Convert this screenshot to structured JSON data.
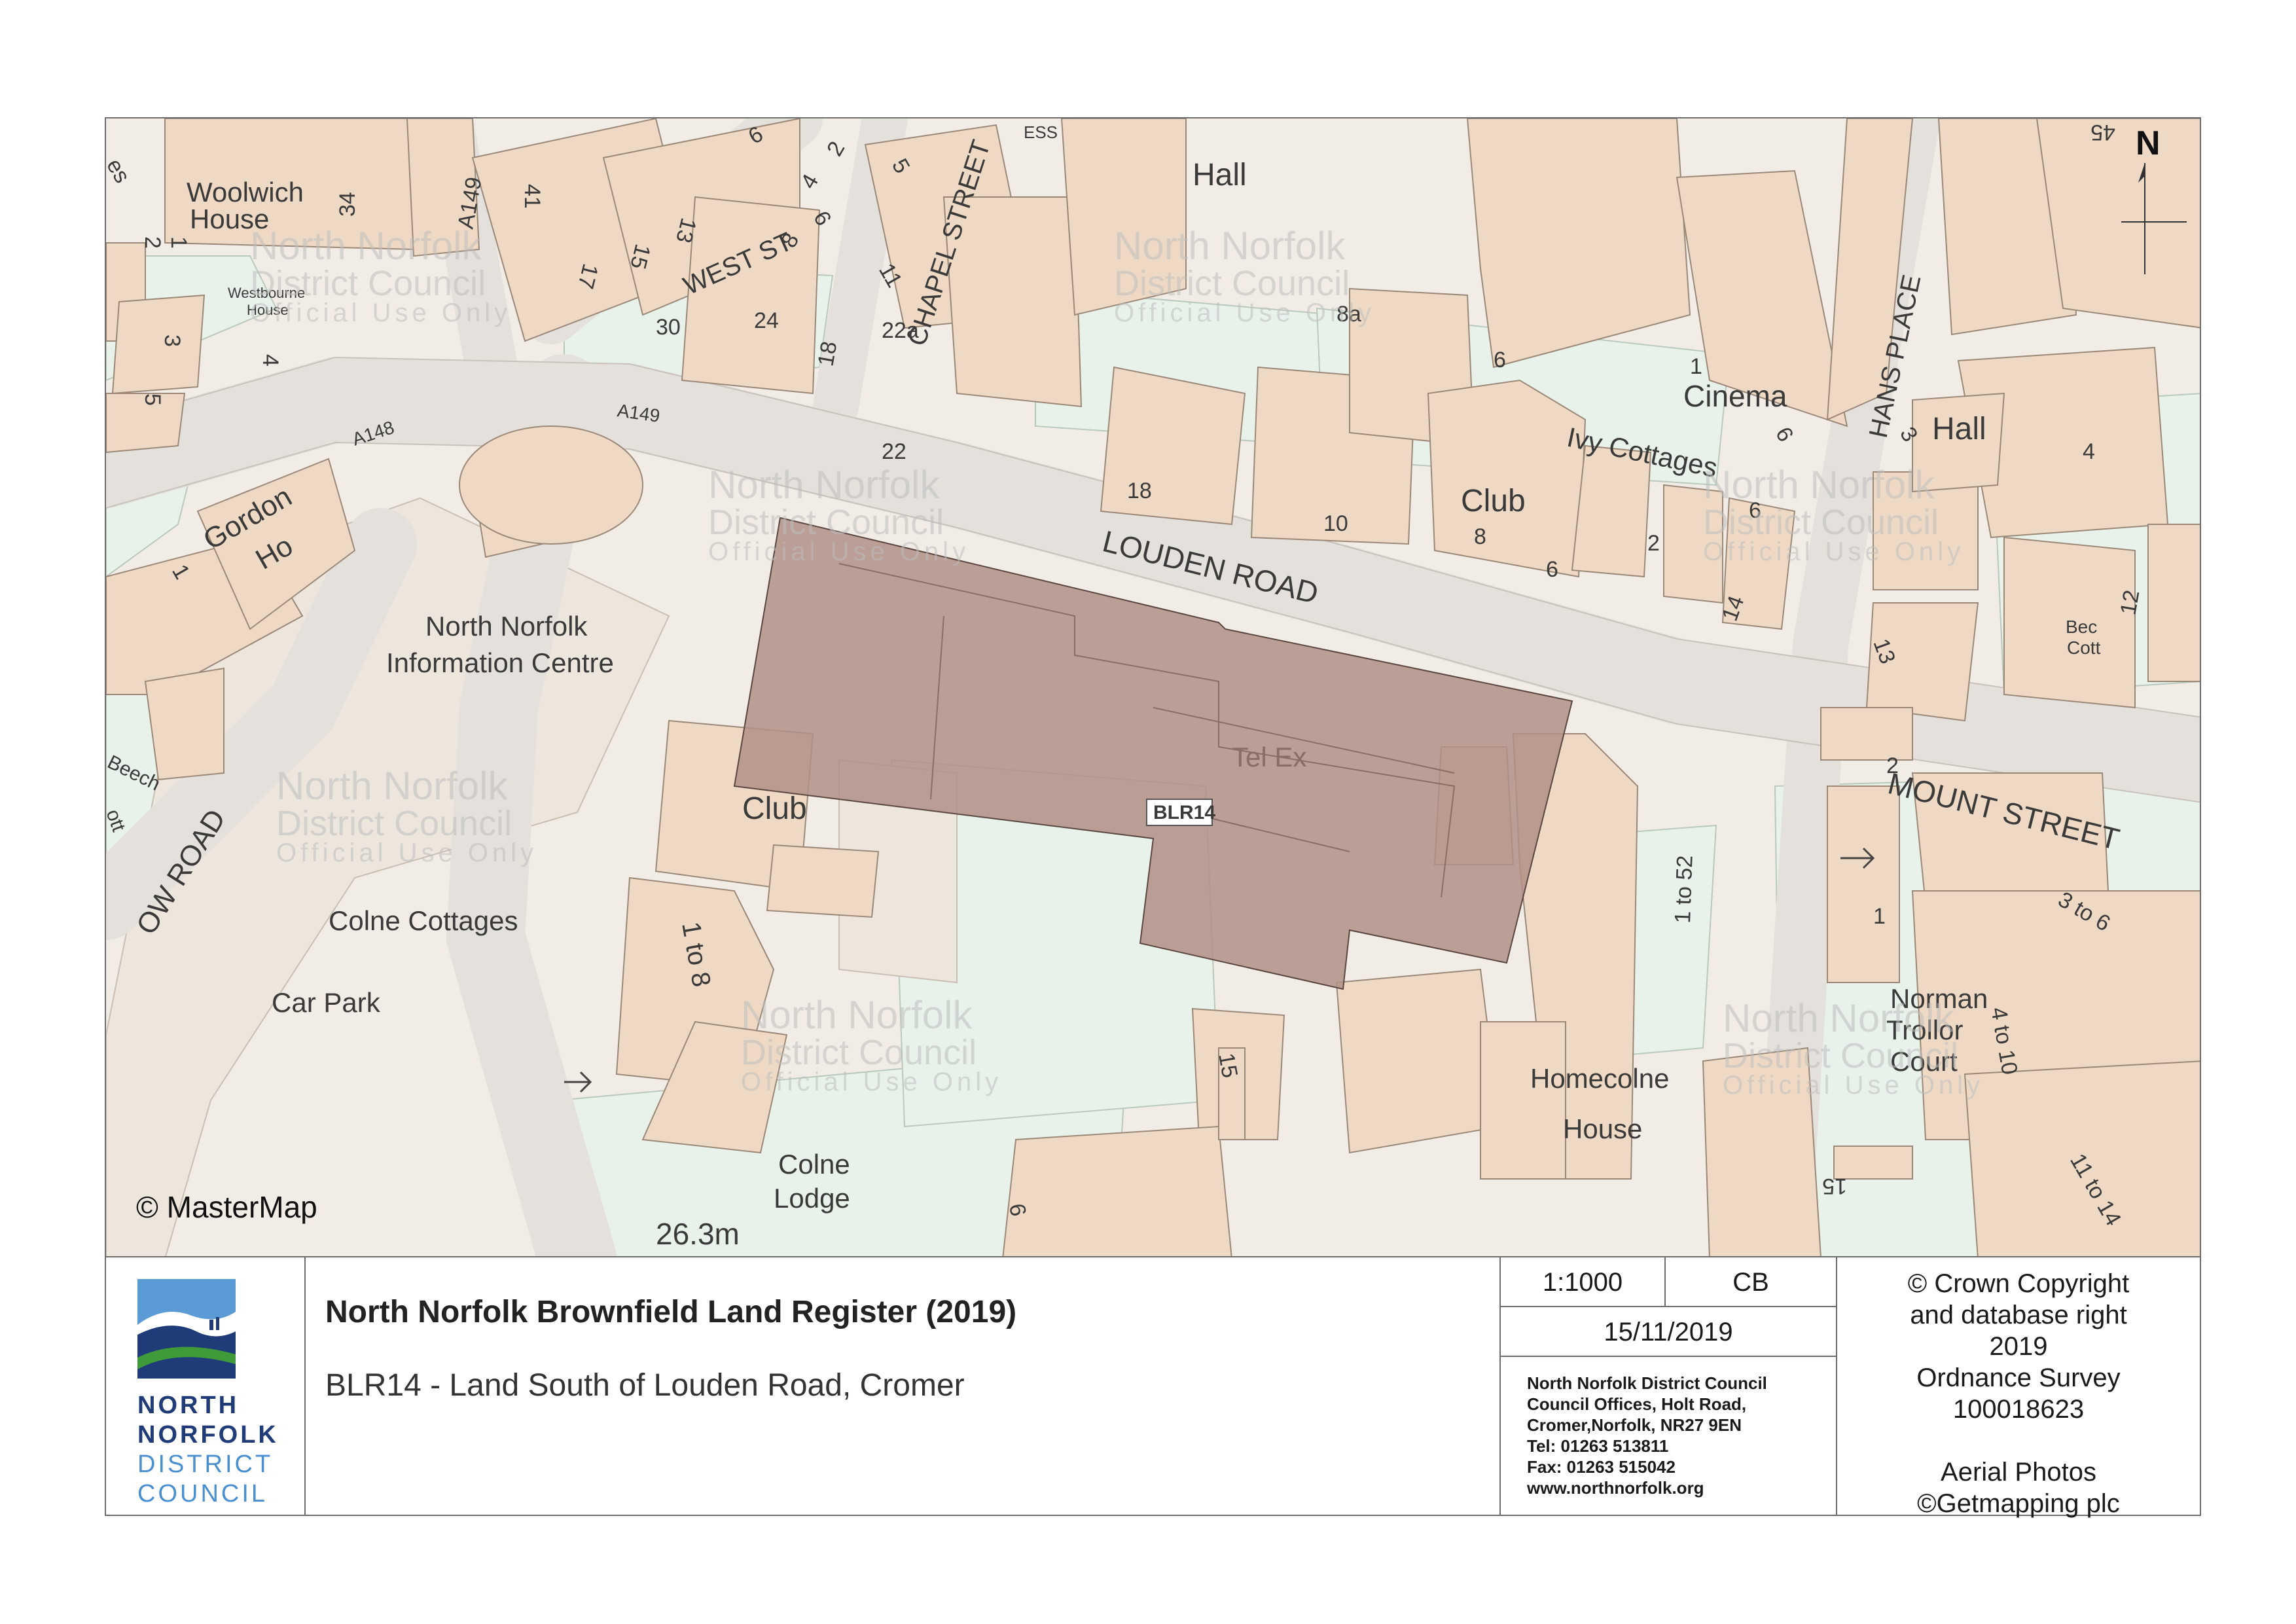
{
  "map": {
    "attribution": "© MasterMap",
    "north_label": "N",
    "site_label": "BLR14",
    "spot_height": "26.3m",
    "colors": {
      "building": "#eed9c4",
      "green_space": "#e9f2ea",
      "road": "#e7e3df",
      "site_fill": "#b28f87",
      "building_edge": "#9a8878"
    },
    "roads": [
      {
        "name": "LOUDEN   ROAD"
      },
      {
        "name": "MOUNT STREET"
      },
      {
        "name": "CHAPEL STREET"
      },
      {
        "name": "HANS PLACE"
      },
      {
        "name": "WEST ST"
      },
      {
        "name": "A149"
      },
      {
        "name": "A149"
      },
      {
        "name": "A148"
      },
      {
        "name": "OW  ROAD"
      }
    ],
    "places": [
      {
        "name": "Woolwich"
      },
      {
        "name": "House"
      },
      {
        "name": "Hall"
      },
      {
        "name": "Cinema"
      },
      {
        "name": "Hall"
      },
      {
        "name": "Ivy Cottages"
      },
      {
        "name": "Club"
      },
      {
        "name": "Club"
      },
      {
        "name": "Gordon"
      },
      {
        "name": "Ho"
      },
      {
        "name": "North Norfolk"
      },
      {
        "name": "Information Centre"
      },
      {
        "name": "Tel Ex"
      },
      {
        "name": "Colne Cottages"
      },
      {
        "name": "Car Park"
      },
      {
        "name": "Colne"
      },
      {
        "name": "Lodge"
      },
      {
        "name": "Homecolne"
      },
      {
        "name": "House"
      },
      {
        "name": "Norman"
      },
      {
        "name": "Trollor"
      },
      {
        "name": "Court"
      },
      {
        "name": "Bec"
      },
      {
        "name": "Cott"
      },
      {
        "name": "Westbourne"
      },
      {
        "name": "House"
      },
      {
        "name": "Beech"
      },
      {
        "name": "ott"
      },
      {
        "name": "ESS"
      }
    ],
    "numbers": [
      "41",
      "34",
      "2",
      "1",
      "3",
      "4",
      "5",
      "17",
      "15",
      "13",
      "30",
      "24",
      "18",
      "6",
      "6",
      "2",
      "4",
      "8",
      "5",
      "11",
      "22a",
      "22",
      "18",
      "10",
      "8a",
      "6",
      "1",
      "6",
      "3",
      "6",
      "2",
      "14",
      "13",
      "12",
      "4",
      "45",
      "8",
      "6",
      "1",
      "1 to 8",
      "15",
      "1 to 52",
      "2",
      "1",
      "3 to 6",
      "4 to 10",
      "15",
      "11 to 14",
      "6",
      "es"
    ],
    "watermark": {
      "line1": "North Norfolk",
      "line2": "District Council",
      "line3": "Official Use Only"
    }
  },
  "panel": {
    "logo": {
      "words": [
        "NORTH",
        "NORFOLK",
        "DISTRICT",
        "COUNCIL"
      ],
      "colors": {
        "sky": "#5a9bd5",
        "dark": "#1f3c78",
        "green": "#3f9a3a",
        "word_dark": "#1f3c78",
        "word_light": "#4a8fcf"
      }
    },
    "title": "North Norfolk Brownfield Land Register (2019)",
    "subtitle": "BLR14 - Land South of Louden Road, Cromer",
    "scale": "1:1000",
    "initials": "CB",
    "date": "15/11/2019",
    "address": [
      "North Norfolk District Council",
      "Council Offices, Holt Road,",
      "Cromer,Norfolk, NR27 9EN",
      "Tel: 01263 513811",
      "Fax: 01263 515042",
      "www.northnorfolk.org"
    ],
    "copyright": [
      "© Crown Copyright",
      "and database right",
      "2019",
      "Ordnance Survey",
      "100018623",
      "",
      "Aerial Photos",
      "©Getmapping plc"
    ]
  }
}
